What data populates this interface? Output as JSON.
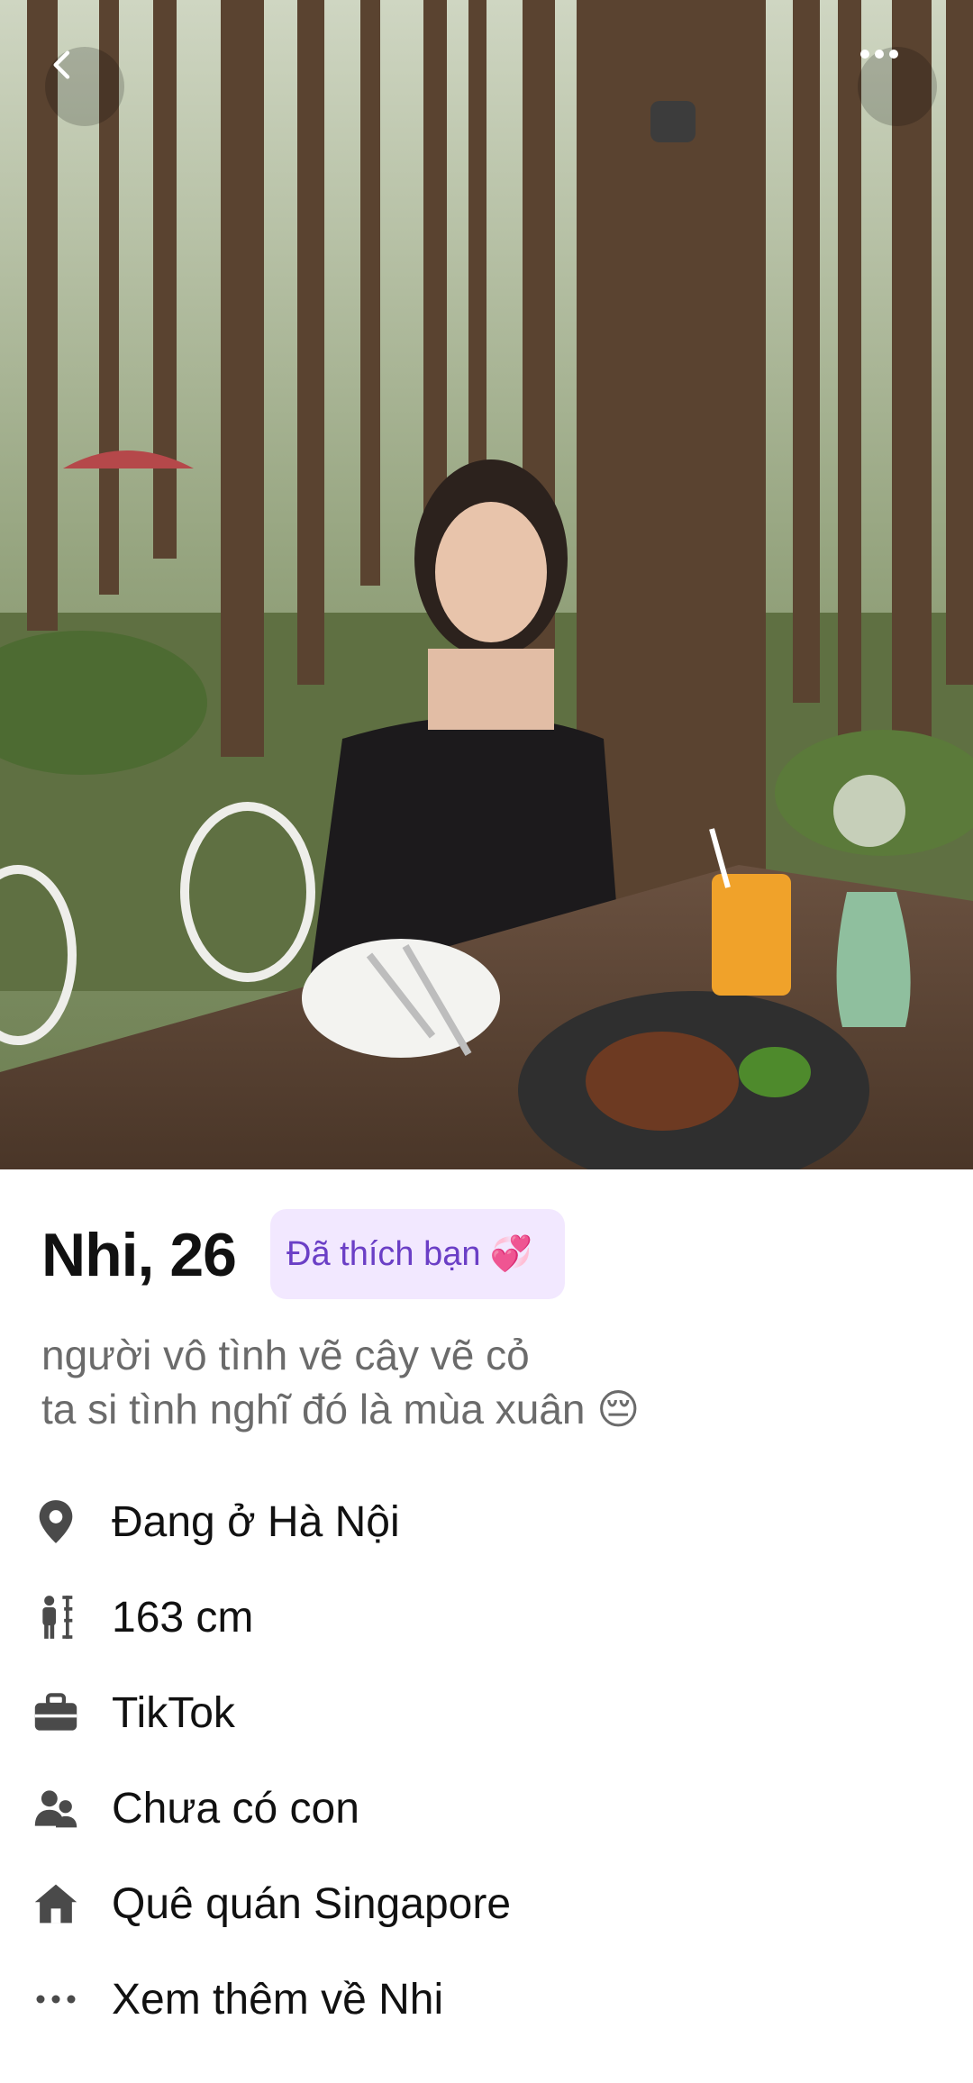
{
  "header": {
    "back_icon": "chevron-left-icon",
    "more_icon": "more-horizontal-icon"
  },
  "profile": {
    "name_age": "Nhi, 26",
    "liked_badge": "Đã thích bạn",
    "liked_badge_emoji": "💞",
    "bio_line1": "người vô tình vẽ cây vẽ cỏ",
    "bio_line2": "ta si tình nghĩ đó là mùa xuân 😔"
  },
  "info": [
    {
      "icon": "location-pin-icon",
      "label": "Đang ở Hà Nội"
    },
    {
      "icon": "height-icon",
      "label": "163 cm"
    },
    {
      "icon": "briefcase-icon",
      "label": "TikTok"
    },
    {
      "icon": "people-icon",
      "label": "Chưa có con"
    },
    {
      "icon": "home-icon",
      "label": "Quê quán Singapore"
    },
    {
      "icon": "more-icon",
      "label": "Xem thêm về Nhi"
    }
  ],
  "colors": {
    "badge_bg": "#f2e8ff",
    "badge_text": "#6b3fc6",
    "icon_gray": "#4a4a4a"
  }
}
